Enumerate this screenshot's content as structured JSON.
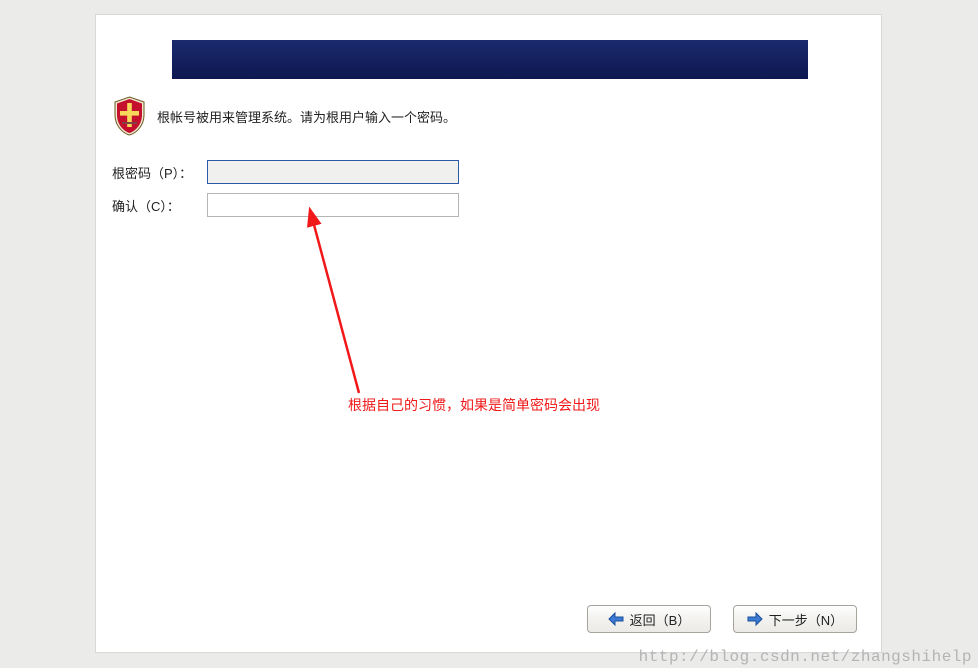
{
  "intro": {
    "text": "根帐号被用来管理系统。请为根用户输入一个密码。"
  },
  "form": {
    "password_label": "根密码（P）：",
    "confirm_label": "确认（C）：",
    "password_value": "",
    "confirm_value": ""
  },
  "annotation": {
    "text": "根据自己的习惯，如果是简单密码会出现"
  },
  "buttons": {
    "back": "返回（B）",
    "next": "下一步（N）"
  },
  "watermark": "http://blog.csdn.net/zhangshihelp",
  "colors": {
    "banner": "#15245f",
    "annotation": "#f01818",
    "arrow_back": "#3c7ad6",
    "arrow_next": "#3c7ad6"
  }
}
